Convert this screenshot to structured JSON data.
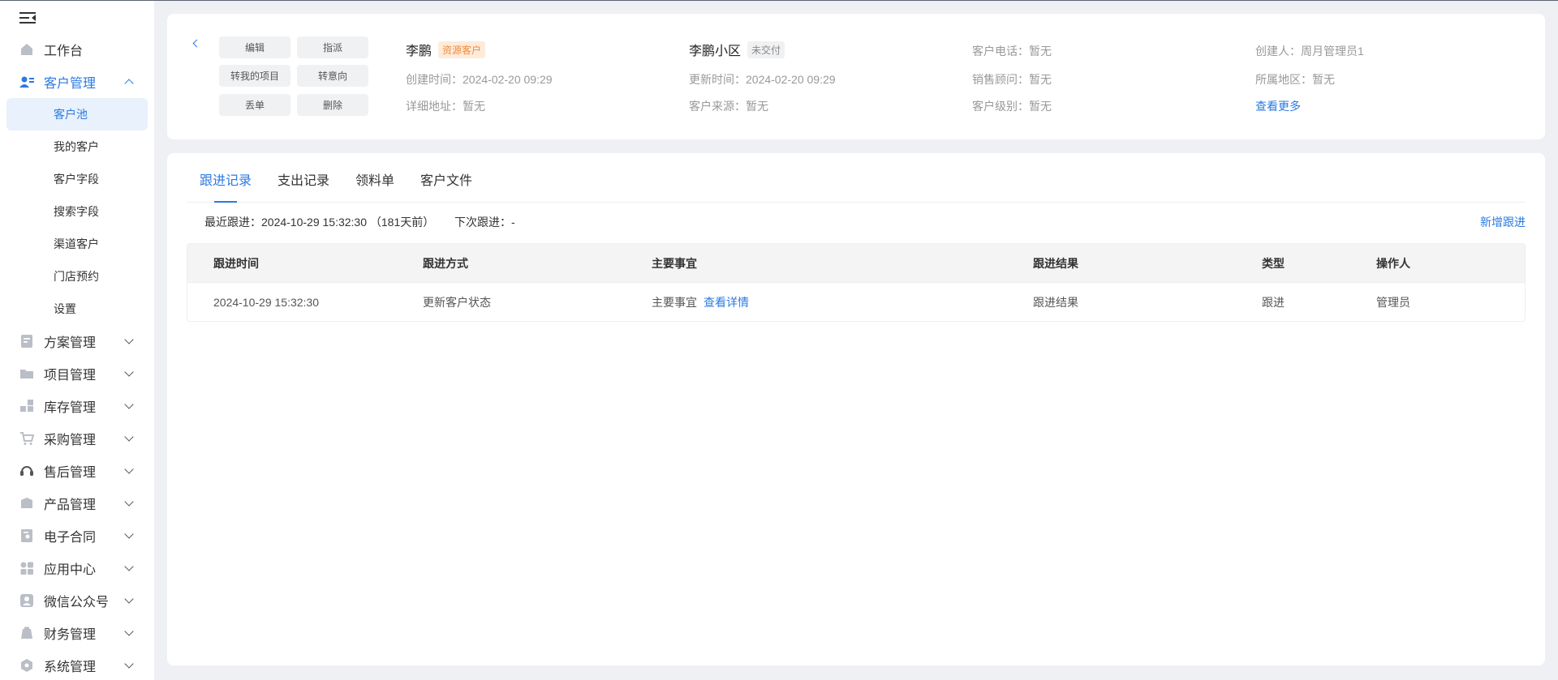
{
  "sidebar": {
    "top_items": [
      {
        "label": "工作台",
        "icon": "home-icon"
      }
    ],
    "customer_mgmt": {
      "label": "客户管理",
      "icon": "customer-icon",
      "sub_items": [
        {
          "label": "客户池",
          "active": true
        },
        {
          "label": "我的客户"
        },
        {
          "label": "客户字段"
        },
        {
          "label": "搜索字段"
        },
        {
          "label": "渠道客户"
        },
        {
          "label": "门店预约"
        },
        {
          "label": "设置"
        }
      ]
    },
    "groups": [
      {
        "label": "方案管理",
        "icon": "plan-icon"
      },
      {
        "label": "项目管理",
        "icon": "folder-icon"
      },
      {
        "label": "库存管理",
        "icon": "inventory-icon"
      },
      {
        "label": "采购管理",
        "icon": "cart-icon"
      },
      {
        "label": "售后管理",
        "icon": "headset-icon"
      },
      {
        "label": "产品管理",
        "icon": "box-icon"
      },
      {
        "label": "电子合同",
        "icon": "contract-icon"
      },
      {
        "label": "应用中心",
        "icon": "apps-icon"
      },
      {
        "label": "微信公众号",
        "icon": "wechat-icon"
      },
      {
        "label": "财务管理",
        "icon": "finance-icon"
      },
      {
        "label": "系统管理",
        "icon": "settings-icon"
      }
    ]
  },
  "customer": {
    "actions": {
      "edit": "编辑",
      "assign": "指派",
      "to_my_project": "转我的项目",
      "to_intent": "转意向",
      "drop": "丢单",
      "delete": "删除"
    },
    "name": "李鹏",
    "name_tag": "资源客户",
    "created_time": "创建时间：2024-02-20 09:29",
    "address": "详细地址：暂无",
    "community": "李鹏小区",
    "community_tag": "未交付",
    "updated_time": "更新时间：2024-02-20 09:29",
    "source": "客户来源：暂无",
    "phone": "客户电话：暂无",
    "sales": "销售顾问：暂无",
    "level": "客户级别：暂无",
    "creator": "创建人：周月管理员1",
    "region": "所属地区：暂无",
    "more": "查看更多"
  },
  "tabs": [
    "跟进记录",
    "支出记录",
    "领料单",
    "客户文件"
  ],
  "follow": {
    "latest": "最近跟进：2024-10-29 15:32:30 （181天前）",
    "next": "下次跟进：-",
    "add_label": "新增跟进"
  },
  "table": {
    "headers": [
      "跟进时间",
      "跟进方式",
      "主要事宜",
      "跟进结果",
      "类型",
      "操作人"
    ],
    "rows": [
      {
        "time": "2024-10-29 15:32:30",
        "method": "更新客户状态",
        "matter": "主要事宜",
        "detail_link": "查看详情",
        "result": "跟进结果",
        "type": "跟进",
        "operator": "管理员"
      }
    ]
  },
  "colors": {
    "accent": "#2a7ae2",
    "tag_orange": "#f08a3c"
  }
}
